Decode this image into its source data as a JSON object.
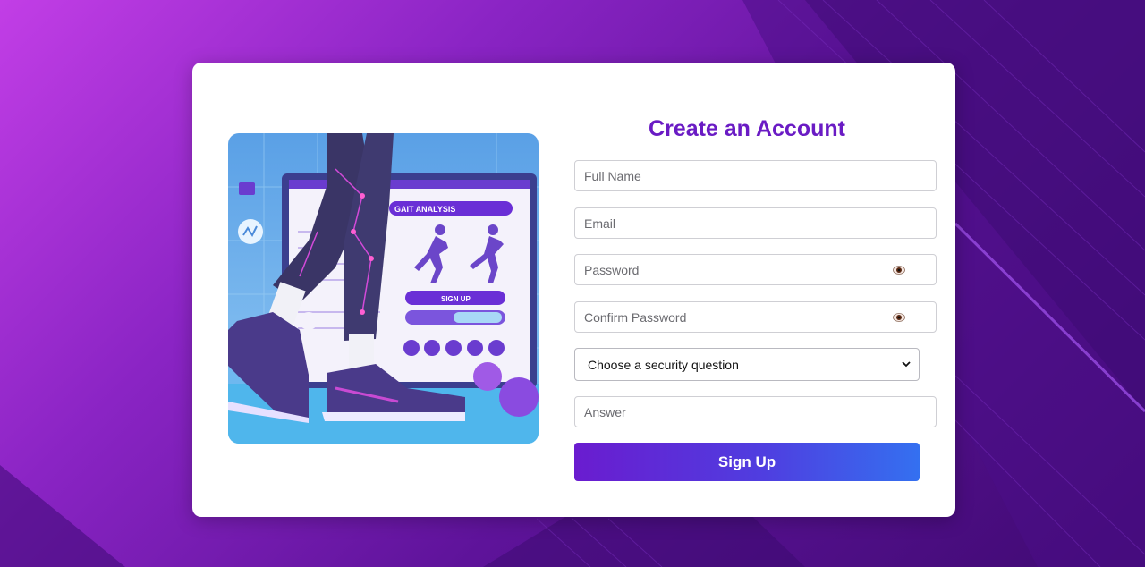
{
  "form": {
    "title": "Create an Account",
    "full_name_placeholder": "Full Name",
    "email_placeholder": "Email",
    "password_placeholder": "Password",
    "confirm_password_placeholder": "Confirm Password",
    "security_question_selected": "Choose a security question",
    "answer_placeholder": "Answer",
    "signup_label": "Sign Up"
  },
  "illustration": {
    "panel_heading": "GAIT ANALYSIS",
    "panel_button": "SIGN UP"
  },
  "colors": {
    "accent": "#6a1bc4",
    "button_start": "#6a1ccf",
    "button_end": "#3470f0"
  }
}
